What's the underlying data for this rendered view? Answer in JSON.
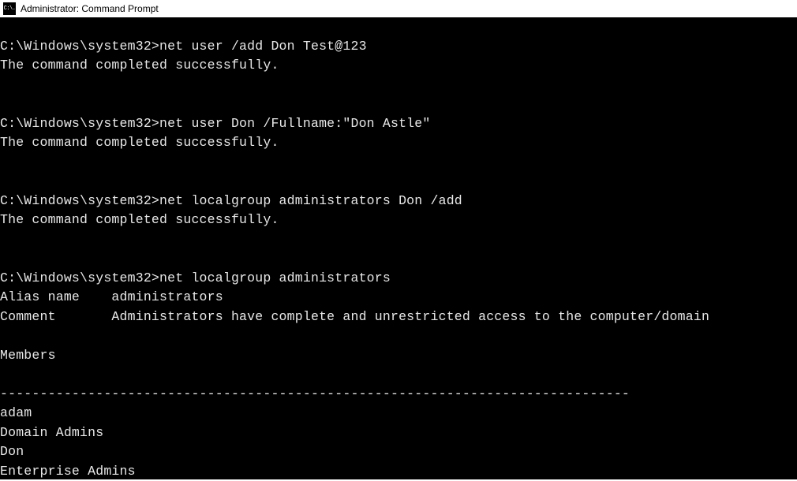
{
  "window": {
    "icon_text": "C:\\.",
    "title": "Administrator: Command Prompt"
  },
  "terminal": {
    "blocks": [
      {
        "prompt": "C:\\Windows\\system32>",
        "command": "net user /add Don Test@123",
        "response": "The command completed successfully."
      },
      {
        "prompt": "C:\\Windows\\system32>",
        "command": "net user Don /Fullname:\"Don Astle\"",
        "response": "The command completed successfully."
      },
      {
        "prompt": "C:\\Windows\\system32>",
        "command": "net localgroup administrators Don /add",
        "response": "The command completed successfully."
      }
    ],
    "group_listing": {
      "prompt": "C:\\Windows\\system32>",
      "command": "net localgroup administrators",
      "alias_label": "Alias name",
      "alias_value": "administrators",
      "comment_label": "Comment",
      "comment_value": "Administrators have complete and unrestricted access to the computer/domain",
      "members_header": "Members",
      "separator": "-------------------------------------------------------------------------------",
      "members": [
        "adam",
        "Domain Admins",
        "Don",
        "Enterprise Admins"
      ]
    }
  }
}
